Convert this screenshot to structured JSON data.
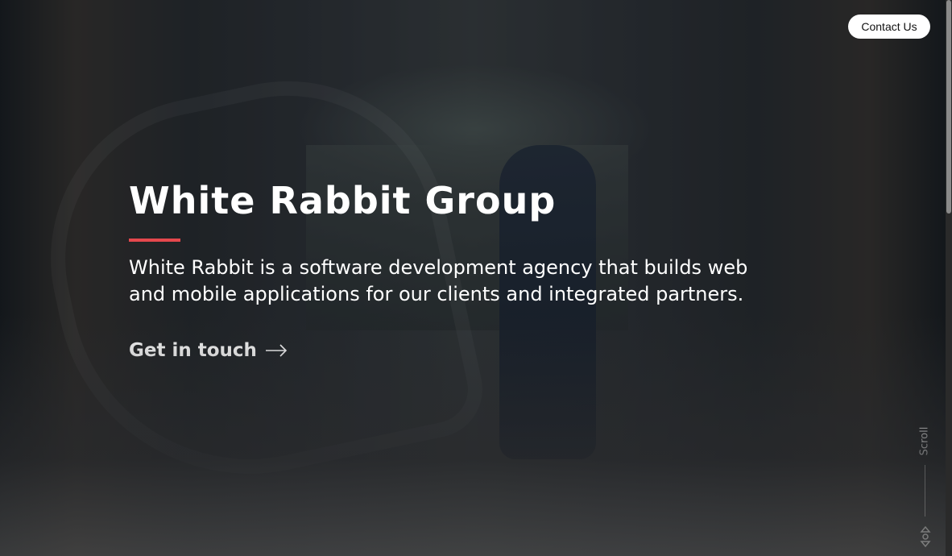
{
  "header": {
    "contact_label": "Contact Us"
  },
  "hero": {
    "title": "White Rabbit Group",
    "description": "White Rabbit is a software development agency that builds web and mobile applications for our clients and integrated partners.",
    "cta_label": "Get in touch",
    "accent_color": "#e5484d"
  },
  "scroll": {
    "label": "Scroll"
  }
}
